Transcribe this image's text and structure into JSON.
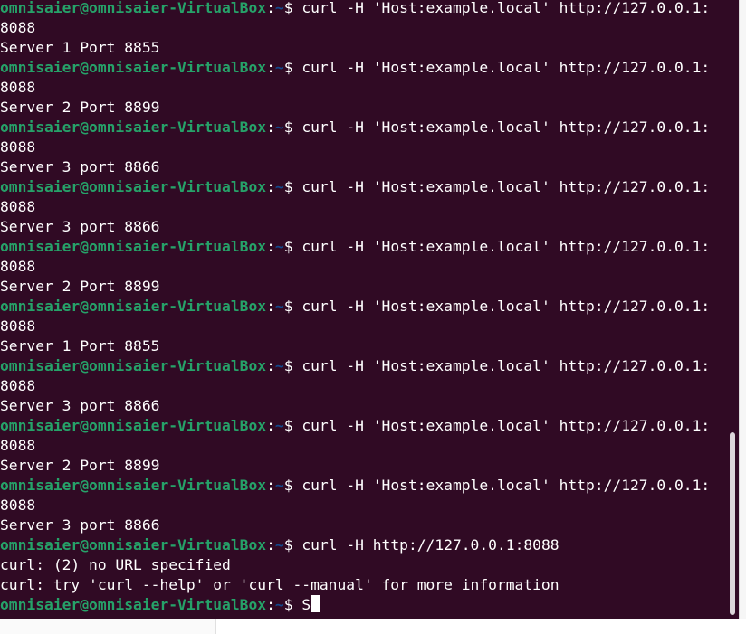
{
  "terminal": {
    "prompt_user": "omnisaier@omnisaier-VirtualBox",
    "prompt_path": "~",
    "prompt_sep": ":",
    "prompt_symbol": "$",
    "lines": [
      {
        "type": "prompt",
        "cmd": " curl -H 'Host:example.local' http://127.0.0.1:"
      },
      {
        "type": "output",
        "text": "8088"
      },
      {
        "type": "output",
        "text": "Server 1 Port 8855"
      },
      {
        "type": "prompt",
        "cmd": " curl -H 'Host:example.local' http://127.0.0.1:"
      },
      {
        "type": "output",
        "text": "8088"
      },
      {
        "type": "output",
        "text": "Server 2 Port 8899"
      },
      {
        "type": "prompt",
        "cmd": " curl -H 'Host:example.local' http://127.0.0.1:"
      },
      {
        "type": "output",
        "text": "8088"
      },
      {
        "type": "output",
        "text": "Server 3 port 8866"
      },
      {
        "type": "prompt",
        "cmd": " curl -H 'Host:example.local' http://127.0.0.1:"
      },
      {
        "type": "output",
        "text": "8088"
      },
      {
        "type": "output",
        "text": "Server 3 port 8866"
      },
      {
        "type": "prompt",
        "cmd": " curl -H 'Host:example.local' http://127.0.0.1:"
      },
      {
        "type": "output",
        "text": "8088"
      },
      {
        "type": "output",
        "text": "Server 2 Port 8899"
      },
      {
        "type": "prompt",
        "cmd": " curl -H 'Host:example.local' http://127.0.0.1:"
      },
      {
        "type": "output",
        "text": "8088"
      },
      {
        "type": "output",
        "text": "Server 1 Port 8855"
      },
      {
        "type": "prompt",
        "cmd": " curl -H 'Host:example.local' http://127.0.0.1:"
      },
      {
        "type": "output",
        "text": "8088"
      },
      {
        "type": "output",
        "text": "Server 3 port 8866"
      },
      {
        "type": "prompt",
        "cmd": " curl -H 'Host:example.local' http://127.0.0.1:"
      },
      {
        "type": "output",
        "text": "8088"
      },
      {
        "type": "output",
        "text": "Server 2 Port 8899"
      },
      {
        "type": "prompt",
        "cmd": " curl -H 'Host:example.local' http://127.0.0.1:"
      },
      {
        "type": "output",
        "text": "8088"
      },
      {
        "type": "output",
        "text": "Server 3 port 8866"
      },
      {
        "type": "prompt",
        "cmd": " curl -H http://127.0.0.1:8088"
      },
      {
        "type": "output",
        "text": "curl: (2) no URL specified"
      },
      {
        "type": "output",
        "text": "curl: try 'curl --help' or 'curl --manual' for more information"
      },
      {
        "type": "prompt",
        "cmd": " S",
        "cursor": true
      }
    ]
  },
  "colors": {
    "background": "#300a24",
    "user": "#26a269",
    "path": "#12488b",
    "text": "#ffffff"
  }
}
